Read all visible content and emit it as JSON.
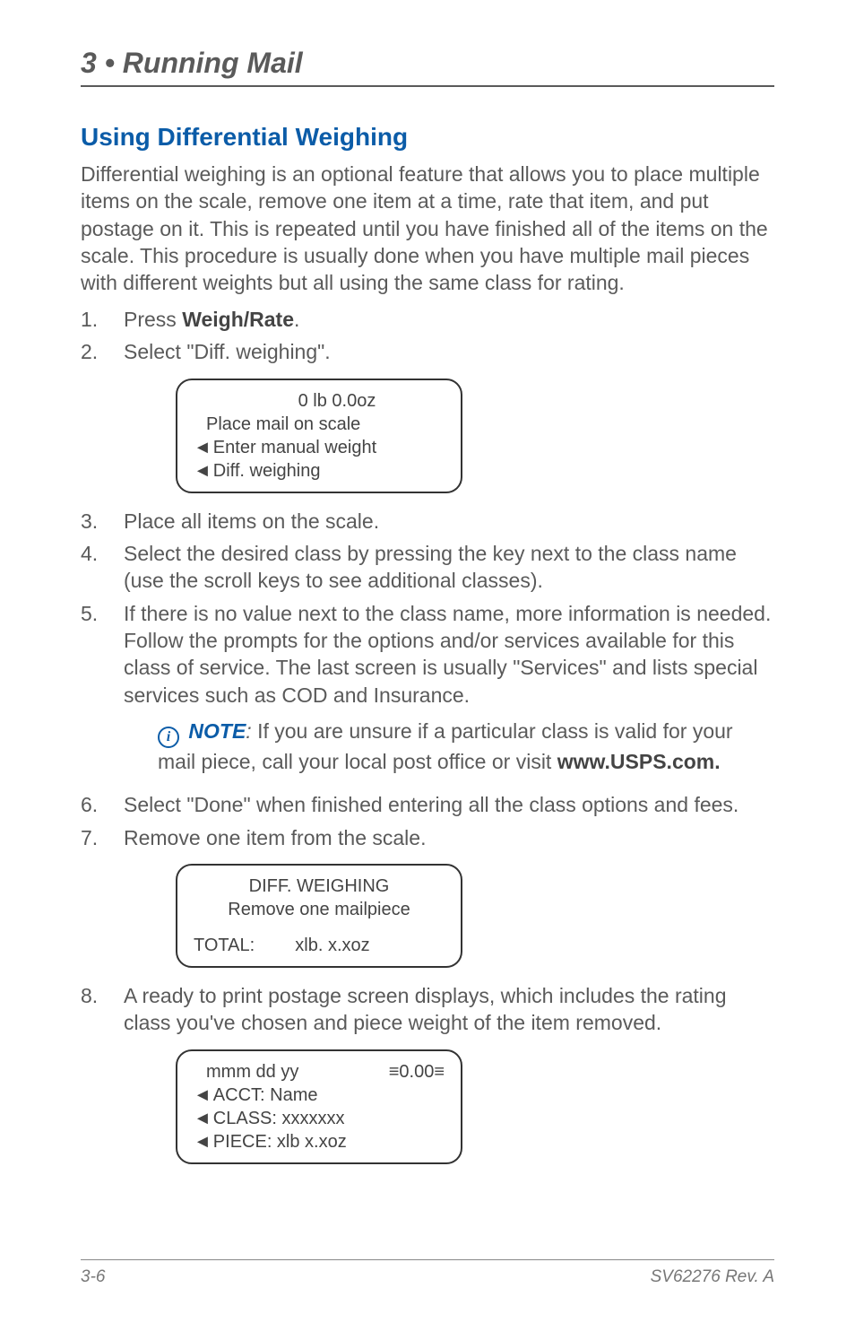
{
  "chapter": "3 • Running Mail",
  "section_title": "Using Differential Weighing",
  "intro": "Differential weighing is an optional feature that allows you to place multiple items on the scale, remove one item at a time, rate that item, and put postage on it. This is repeated until you have finished all of the items on the scale. This procedure is usually done when you have multiple mail pieces with different weights but all using the same class for rating.",
  "steps": {
    "s1_a": "Press ",
    "s1_b": "Weigh/Rate",
    "s1_c": ".",
    "s2": "Select \"Diff. weighing\".",
    "s3": "Place all items on the scale.",
    "s4": "Select the desired class by pressing the key next to the class name (use the scroll keys to see additional classes).",
    "s5": "If there is no value next to the class name, more information is needed. Follow the prompts for the options and/or services available for this class of service. The last screen is usually \"Services\" and lists special services such as COD and Insurance.",
    "s6": "Select \"Done\" when finished entering all the class options and fees.",
    "s7": "Remove one item from the scale.",
    "s8": "A ready to print postage screen displays, which includes the rating class you've chosen and piece weight of the item removed."
  },
  "note": {
    "label": "NOTE",
    "sep": ": ",
    "text_a": "If you are unsure if a particular class is valid for your mail piece, call your local post office or visit ",
    "text_b": "www.USPS.com."
  },
  "screen1": {
    "l1": "0 lb  0.0oz",
    "l2": "Place mail on scale",
    "l3": "Enter manual weight",
    "l4": "Diff. weighing"
  },
  "screen2": {
    "l1": "DIFF.  WEIGHING",
    "l2": "Remove one mailpiece",
    "l3a": "TOTAL:",
    "l3b": "xlb.  x.xoz"
  },
  "screen3": {
    "l1a": "mmm dd yy",
    "l1b": "≡0.00≡",
    "l2": "ACCT:  Name",
    "l3": "CLASS:  xxxxxxx",
    "l4": "PIECE:   xlb x.xoz"
  },
  "footer": {
    "left": "3-6",
    "right": "SV62276 Rev. A"
  }
}
